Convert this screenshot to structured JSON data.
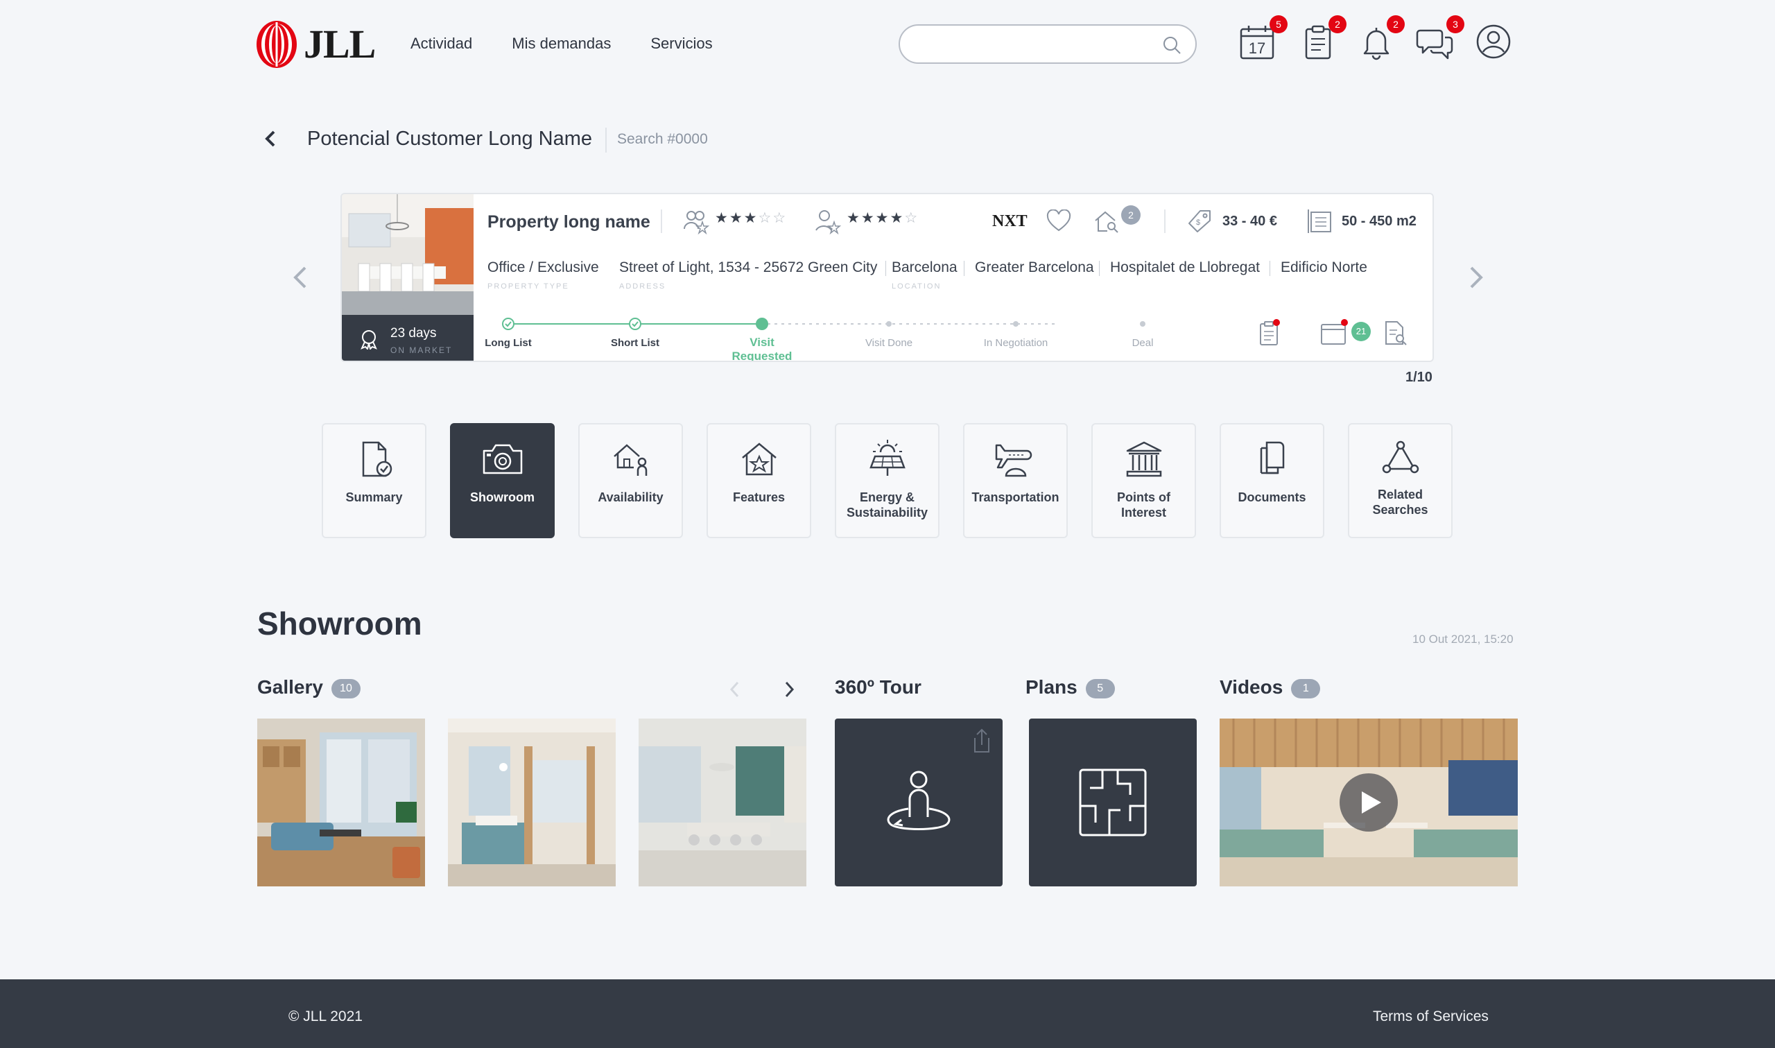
{
  "header": {
    "logo": "JLL",
    "nav": [
      "Actividad",
      "Mis demandas",
      "Servicios"
    ],
    "search_placeholder": "",
    "icons": [
      {
        "name": "calendar-icon",
        "day": "17",
        "badge": "5"
      },
      {
        "name": "requests-icon",
        "badge": "2"
      },
      {
        "name": "bell-icon",
        "badge": "2"
      },
      {
        "name": "chat-icon",
        "badge": "3"
      },
      {
        "name": "user-icon"
      }
    ],
    "badge_color": "#e30613"
  },
  "customer": {
    "name": "Potencial Customer Long Name",
    "search_id": "Search #0000"
  },
  "property": {
    "name": "Property long name",
    "rating_a": 3,
    "rating_b": 4,
    "rating_max": 5,
    "brand": "NXT",
    "listings_badge": "2",
    "price_range": "33 - 40 €",
    "area_range": "50 - 450 m2",
    "days_on_market": "23 days",
    "days_on_market_label": "ON MARKET",
    "type": "Office / Exclusive",
    "type_label": "PROPERTY TYPE",
    "address": "Street of Light, 1534 - 25672 Green City",
    "address_label": "ADDRESS",
    "location": "Barcelona",
    "location_label": "LOCATION",
    "area": "Greater Barcelona",
    "municipality": "Hospitalet de Llobregat",
    "building": "Edificio Norte",
    "pipeline": [
      {
        "label": "Long List",
        "state": "done"
      },
      {
        "label": "Short List",
        "state": "done"
      },
      {
        "label": "Visit Requested",
        "state": "active"
      },
      {
        "label": "Visit Done",
        "state": "todo"
      },
      {
        "label": "In Negotiation",
        "state": "todo"
      },
      {
        "label": "Deal",
        "state": "todo"
      }
    ],
    "calendar_badge": "21",
    "pager": "1/10",
    "accent": "#5fbf93"
  },
  "tabs": [
    {
      "label": "Summary",
      "icon": "document-check-icon"
    },
    {
      "label": "Showroom",
      "icon": "camera-icon",
      "active": true
    },
    {
      "label": "Availability",
      "icon": "house-person-icon"
    },
    {
      "label": "Features",
      "icon": "house-star-icon"
    },
    {
      "label": "Energy & Sustainability",
      "icon": "solar-panel-icon"
    },
    {
      "label": "Transportation",
      "icon": "airplane-icon"
    },
    {
      "label": "Points of Interest",
      "icon": "bank-icon"
    },
    {
      "label": "Documents",
      "icon": "documents-icon"
    },
    {
      "label": "Related Searches",
      "icon": "network-icon"
    }
  ],
  "showroom": {
    "title": "Showroom",
    "updated": "10 Out 2021, 15:20",
    "gallery": {
      "title": "Gallery",
      "count": "10"
    },
    "tour": {
      "title": "360º Tour"
    },
    "plans": {
      "title": "Plans",
      "count": "5"
    },
    "videos": {
      "title": "Videos",
      "count": "1"
    }
  },
  "footer": {
    "copyright": "© JLL 2021",
    "terms": "Terms of Services"
  }
}
